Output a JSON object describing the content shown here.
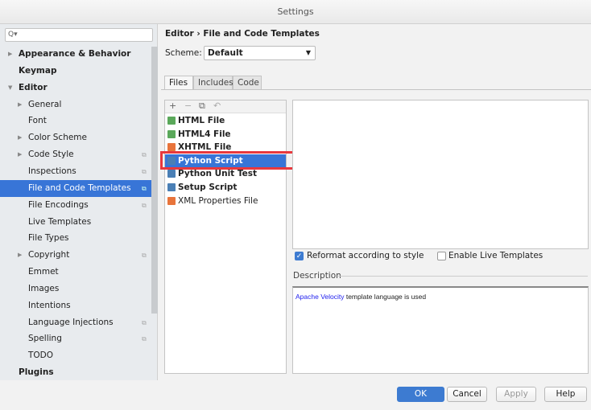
{
  "window": {
    "title": "Settings"
  },
  "sidebar": {
    "search_placeholder": "Q▾",
    "items": [
      {
        "label": "Appearance & Behavior",
        "level": 0,
        "arrow": "▶",
        "badge": ""
      },
      {
        "label": "Keymap",
        "level": 0,
        "arrow": "",
        "badge": ""
      },
      {
        "label": "Editor",
        "level": 0,
        "arrow": "▼",
        "badge": ""
      },
      {
        "label": "General",
        "level": 1,
        "arrow": "▶",
        "badge": ""
      },
      {
        "label": "Font",
        "level": 1,
        "arrow": "",
        "badge": ""
      },
      {
        "label": "Color Scheme",
        "level": 1,
        "arrow": "▶",
        "badge": ""
      },
      {
        "label": "Code Style",
        "level": 1,
        "arrow": "▶",
        "badge": "⧉"
      },
      {
        "label": "Inspections",
        "level": 1,
        "arrow": "",
        "badge": "⧉"
      },
      {
        "label": "File and Code Templates",
        "level": 1,
        "arrow": "",
        "badge": "⧉",
        "selected": true
      },
      {
        "label": "File Encodings",
        "level": 1,
        "arrow": "",
        "badge": "⧉"
      },
      {
        "label": "Live Templates",
        "level": 1,
        "arrow": "",
        "badge": ""
      },
      {
        "label": "File Types",
        "level": 1,
        "arrow": "",
        "badge": ""
      },
      {
        "label": "Copyright",
        "level": 1,
        "arrow": "▶",
        "badge": "⧉"
      },
      {
        "label": "Emmet",
        "level": 1,
        "arrow": "",
        "badge": ""
      },
      {
        "label": "Images",
        "level": 1,
        "arrow": "",
        "badge": ""
      },
      {
        "label": "Intentions",
        "level": 1,
        "arrow": "",
        "badge": ""
      },
      {
        "label": "Language Injections",
        "level": 1,
        "arrow": "",
        "badge": "⧉"
      },
      {
        "label": "Spelling",
        "level": 1,
        "arrow": "",
        "badge": "⧉"
      },
      {
        "label": "TODO",
        "level": 1,
        "arrow": "",
        "badge": ""
      },
      {
        "label": "Plugins",
        "level": 0,
        "arrow": "",
        "badge": ""
      }
    ]
  },
  "main": {
    "breadcrumb": "Editor  ›  File and Code Templates",
    "scheme_label": "Scheme:",
    "scheme_value": "Default",
    "tabs": [
      {
        "label": "Files",
        "active": true
      },
      {
        "label": "Includes"
      },
      {
        "label": "Code"
      }
    ],
    "toolbar": {
      "add": "+",
      "remove": "−",
      "copy": "⧉",
      "reset": "↶"
    },
    "templates": [
      {
        "label": "HTML File",
        "icon": "html-file-icon",
        "color": "#5aa85a",
        "bold": true
      },
      {
        "label": "HTML4 File",
        "icon": "html-file-icon",
        "color": "#5aa85a",
        "bold": true
      },
      {
        "label": "XHTML File",
        "icon": "xhtml-file-icon",
        "color": "#e8743b",
        "bold": true
      },
      {
        "label": "Python Script",
        "icon": "python-icon",
        "color": "#4a7fb5",
        "bold": true,
        "selected": true
      },
      {
        "label": "Python Unit Test",
        "icon": "python-icon",
        "color": "#4a7fb5",
        "bold": true
      },
      {
        "label": "Setup Script",
        "icon": "python-icon",
        "color": "#4a7fb5",
        "bold": true
      },
      {
        "label": "XML Properties File",
        "icon": "xml-file-icon",
        "color": "#e8743b",
        "bold": false
      }
    ],
    "reformat": {
      "label": "Reformat according to style",
      "checked": true
    },
    "live_templates": {
      "label": "Enable Live Templates",
      "checked": false
    },
    "description_label": "Description",
    "description": {
      "link": "Apache Velocity",
      "text": " template language is used"
    }
  },
  "buttons": {
    "ok": "OK",
    "cancel": "Cancel",
    "apply": "Apply",
    "help": "Help"
  },
  "colors": {
    "accent": "#3875d7",
    "highlight_box": "#e8383d",
    "link": "#2222ee"
  }
}
